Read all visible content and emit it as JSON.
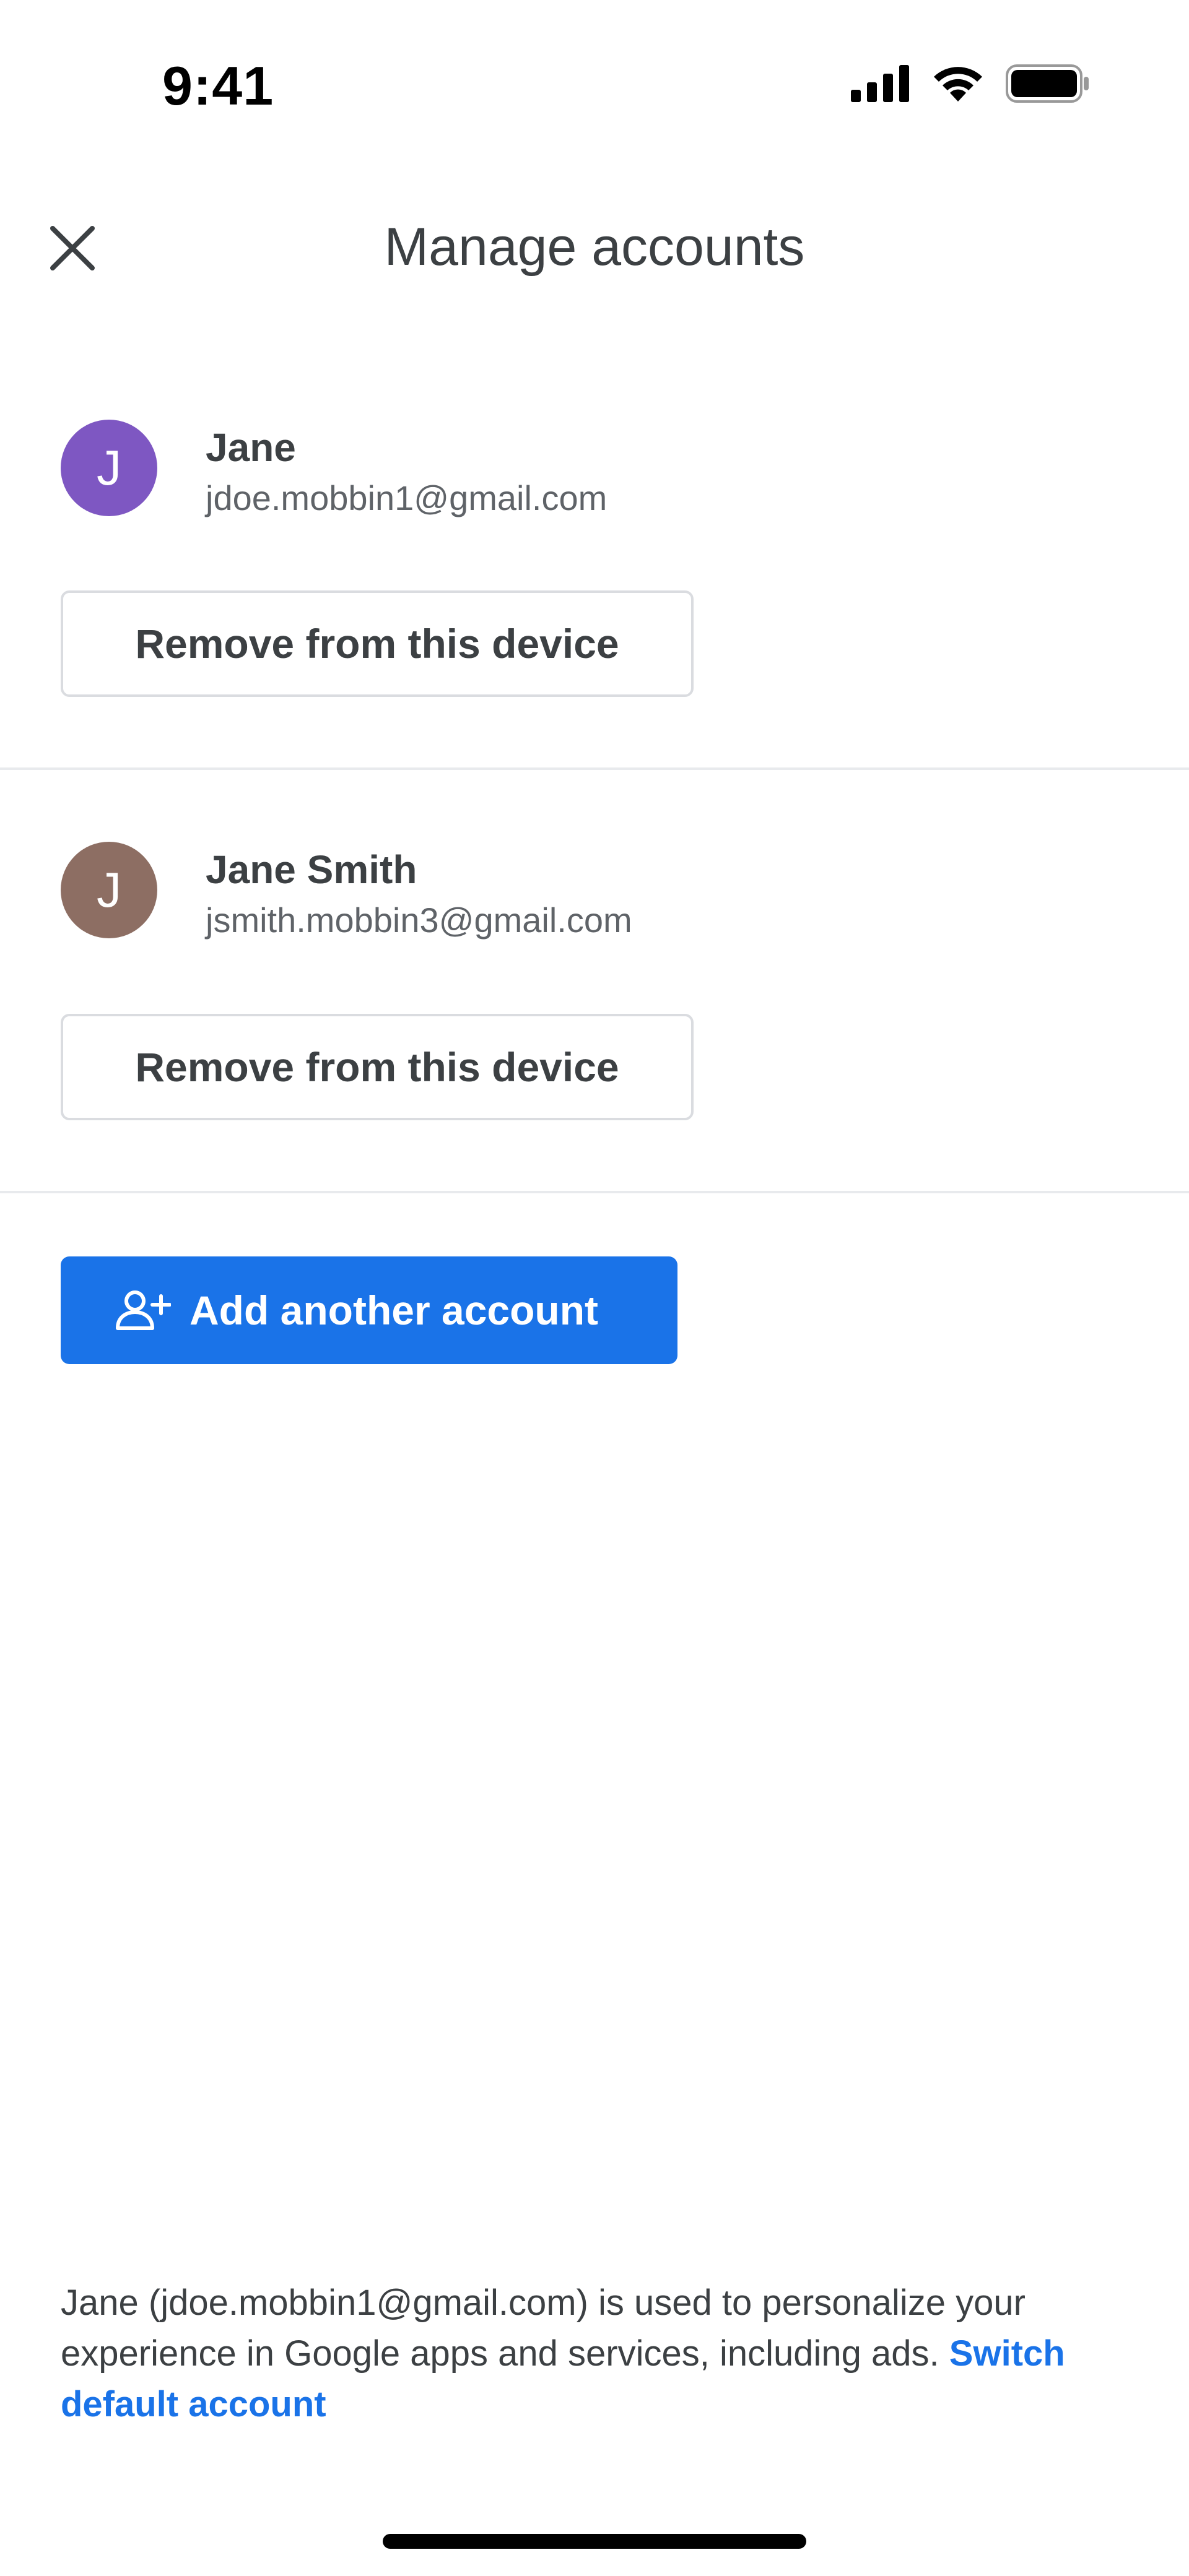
{
  "status_bar": {
    "time": "9:41",
    "icons": [
      "cellular-signal-icon",
      "wifi-icon",
      "battery-icon"
    ]
  },
  "header": {
    "title": "Manage accounts",
    "close_icon": "close-icon"
  },
  "accounts": [
    {
      "initial": "J",
      "name": "Jane",
      "email": "jdoe.mobbin1@gmail.com",
      "avatar_color": "#7e57c2",
      "remove_label": "Remove from this device"
    },
    {
      "initial": "J",
      "name": "Jane Smith",
      "email": "jsmith.mobbin3@gmail.com",
      "avatar_color": "#8d6e63",
      "remove_label": "Remove from this device"
    }
  ],
  "add_account": {
    "label": "Add another account",
    "icon": "add-person-icon"
  },
  "footer": {
    "text": "Jane (jdoe.mobbin1@gmail.com) is used to personalize your experience in Google apps and services, including ads.",
    "link": "Switch default account"
  },
  "colors": {
    "accent": "#1a73e8",
    "text_primary": "#3c4043",
    "text_secondary": "#5f6368",
    "divider": "#e8eaed"
  }
}
